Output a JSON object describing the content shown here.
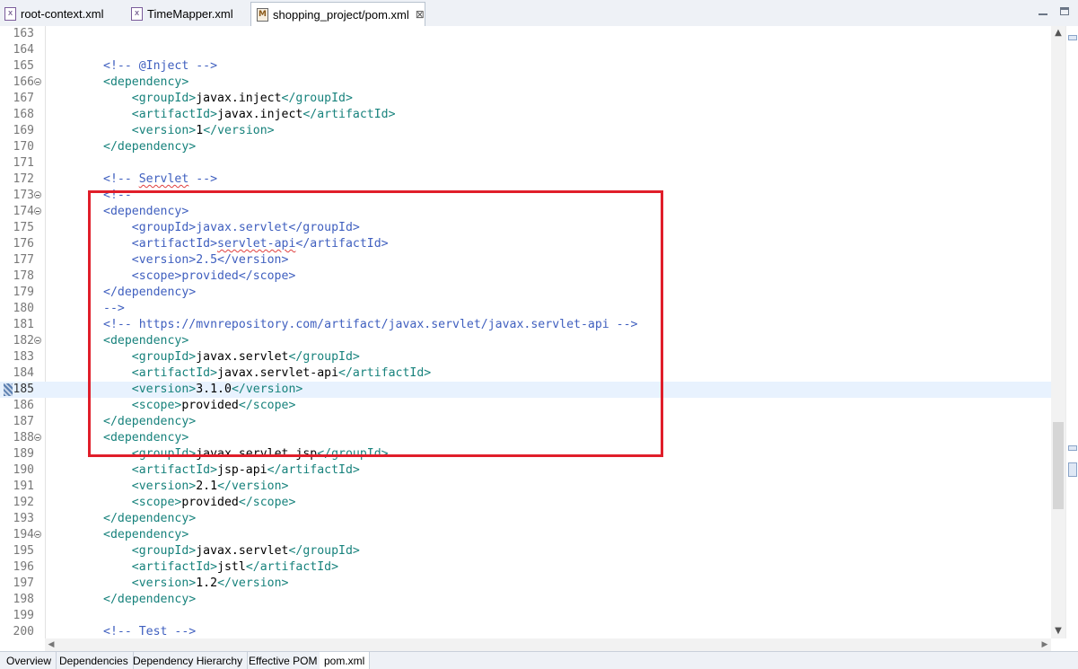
{
  "tabs": [
    {
      "label": "root-context.xml",
      "icon": "xml-file-error-icon"
    },
    {
      "label": "TimeMapper.xml",
      "icon": "xml-file-icon"
    },
    {
      "label": "shopping_project/pom.xml",
      "icon": "maven-pom-icon",
      "active": true,
      "close": "⊠"
    }
  ],
  "lines": [
    {
      "n": "163",
      "tokens": []
    },
    {
      "n": "164",
      "tokens": []
    },
    {
      "n": "165",
      "tokens": [
        {
          "c": "com",
          "t": "<!-- @Inject -->"
        }
      ]
    },
    {
      "n": "166",
      "fold": true,
      "tokens": [
        {
          "c": "tag",
          "t": "<dependency>"
        }
      ]
    },
    {
      "n": "167",
      "tokens": [
        {
          "c": "sp",
          "t": "    "
        },
        {
          "c": "tag",
          "t": "<groupId>"
        },
        {
          "c": "txt",
          "t": "javax.inject"
        },
        {
          "c": "tag",
          "t": "</groupId>"
        }
      ]
    },
    {
      "n": "168",
      "tokens": [
        {
          "c": "sp",
          "t": "    "
        },
        {
          "c": "tag",
          "t": "<artifactId>"
        },
        {
          "c": "txt",
          "t": "javax.inject"
        },
        {
          "c": "tag",
          "t": "</artifactId>"
        }
      ]
    },
    {
      "n": "169",
      "tokens": [
        {
          "c": "sp",
          "t": "    "
        },
        {
          "c": "tag",
          "t": "<version>"
        },
        {
          "c": "txt",
          "t": "1"
        },
        {
          "c": "tag",
          "t": "</version>"
        }
      ]
    },
    {
      "n": "170",
      "tokens": [
        {
          "c": "tag",
          "t": "</dependency>"
        }
      ]
    },
    {
      "n": "171",
      "tokens": []
    },
    {
      "n": "172",
      "tokens": [
        {
          "c": "com",
          "t": "<!-- "
        },
        {
          "c": "com squig",
          "t": "Servlet"
        },
        {
          "c": "com",
          "t": " -->"
        }
      ]
    },
    {
      "n": "173",
      "fold": true,
      "tokens": [
        {
          "c": "com",
          "t": "<!--"
        }
      ]
    },
    {
      "n": "174",
      "fold": true,
      "tokens": [
        {
          "c": "com",
          "t": "<dependency>"
        }
      ]
    },
    {
      "n": "175",
      "tokens": [
        {
          "c": "com",
          "t": "    <groupId>javax.servlet</groupId>"
        }
      ]
    },
    {
      "n": "176",
      "tokens": [
        {
          "c": "com",
          "t": "    <artifactId>"
        },
        {
          "c": "com squig",
          "t": "servlet-api"
        },
        {
          "c": "com",
          "t": "</artifactId>"
        }
      ]
    },
    {
      "n": "177",
      "tokens": [
        {
          "c": "com",
          "t": "    <version>2.5</version>"
        }
      ]
    },
    {
      "n": "178",
      "tokens": [
        {
          "c": "com",
          "t": "    <scope>provided</scope>"
        }
      ]
    },
    {
      "n": "179",
      "tokens": [
        {
          "c": "com",
          "t": "</dependency>"
        }
      ]
    },
    {
      "n": "180",
      "tokens": [
        {
          "c": "com",
          "t": "-->"
        }
      ]
    },
    {
      "n": "181",
      "tokens": [
        {
          "c": "com",
          "t": "<!-- https://mvnrepository.com/artifact/javax.servlet/javax.servlet-api -->"
        }
      ]
    },
    {
      "n": "182",
      "fold": true,
      "tokens": [
        {
          "c": "tag",
          "t": "<dependency>"
        }
      ]
    },
    {
      "n": "183",
      "tokens": [
        {
          "c": "sp",
          "t": "    "
        },
        {
          "c": "tag",
          "t": "<groupId>"
        },
        {
          "c": "txt",
          "t": "javax.servlet"
        },
        {
          "c": "tag",
          "t": "</groupId>"
        }
      ]
    },
    {
      "n": "184",
      "tokens": [
        {
          "c": "sp",
          "t": "    "
        },
        {
          "c": "tag",
          "t": "<artifactId>"
        },
        {
          "c": "txt",
          "t": "javax.servlet-api"
        },
        {
          "c": "tag",
          "t": "</artifactId>"
        }
      ]
    },
    {
      "n": "185",
      "current": true,
      "tokens": [
        {
          "c": "sp",
          "t": "    "
        },
        {
          "c": "tag",
          "t": "<version>"
        },
        {
          "c": "txt",
          "t": "3.1.0"
        },
        {
          "c": "tag",
          "t": "</version>"
        }
      ]
    },
    {
      "n": "186",
      "tokens": [
        {
          "c": "sp",
          "t": "    "
        },
        {
          "c": "tag",
          "t": "<scope>"
        },
        {
          "c": "txt",
          "t": "provided"
        },
        {
          "c": "tag",
          "t": "</scope>"
        }
      ]
    },
    {
      "n": "187",
      "tokens": [
        {
          "c": "tag",
          "t": "</dependency>"
        }
      ]
    },
    {
      "n": "188",
      "fold": true,
      "tokens": [
        {
          "c": "tag",
          "t": "<dependency>"
        }
      ]
    },
    {
      "n": "189",
      "tokens": [
        {
          "c": "sp",
          "t": "    "
        },
        {
          "c": "tag",
          "t": "<groupId>"
        },
        {
          "c": "txt",
          "t": "javax.servlet.jsp"
        },
        {
          "c": "tag",
          "t": "</groupId>"
        }
      ]
    },
    {
      "n": "190",
      "tokens": [
        {
          "c": "sp",
          "t": "    "
        },
        {
          "c": "tag",
          "t": "<artifactId>"
        },
        {
          "c": "txt",
          "t": "jsp-api"
        },
        {
          "c": "tag",
          "t": "</artifactId>"
        }
      ]
    },
    {
      "n": "191",
      "tokens": [
        {
          "c": "sp",
          "t": "    "
        },
        {
          "c": "tag",
          "t": "<version>"
        },
        {
          "c": "txt",
          "t": "2.1"
        },
        {
          "c": "tag",
          "t": "</version>"
        }
      ]
    },
    {
      "n": "192",
      "tokens": [
        {
          "c": "sp",
          "t": "    "
        },
        {
          "c": "tag",
          "t": "<scope>"
        },
        {
          "c": "txt",
          "t": "provided"
        },
        {
          "c": "tag",
          "t": "</scope>"
        }
      ]
    },
    {
      "n": "193",
      "tokens": [
        {
          "c": "tag",
          "t": "</dependency>"
        }
      ]
    },
    {
      "n": "194",
      "fold": true,
      "tokens": [
        {
          "c": "tag",
          "t": "<dependency>"
        }
      ]
    },
    {
      "n": "195",
      "tokens": [
        {
          "c": "sp",
          "t": "    "
        },
        {
          "c": "tag",
          "t": "<groupId>"
        },
        {
          "c": "txt",
          "t": "javax.servlet"
        },
        {
          "c": "tag",
          "t": "</groupId>"
        }
      ]
    },
    {
      "n": "196",
      "tokens": [
        {
          "c": "sp",
          "t": "    "
        },
        {
          "c": "tag",
          "t": "<artifactId>"
        },
        {
          "c": "txt",
          "t": "jstl"
        },
        {
          "c": "tag",
          "t": "</artifactId>"
        }
      ]
    },
    {
      "n": "197",
      "tokens": [
        {
          "c": "sp",
          "t": "    "
        },
        {
          "c": "tag",
          "t": "<version>"
        },
        {
          "c": "txt",
          "t": "1.2"
        },
        {
          "c": "tag",
          "t": "</version>"
        }
      ]
    },
    {
      "n": "198",
      "tokens": [
        {
          "c": "tag",
          "t": "</dependency>"
        }
      ]
    },
    {
      "n": "199",
      "tokens": []
    },
    {
      "n": "200",
      "tokens": [
        {
          "c": "com",
          "t": "<!-- Test -->"
        }
      ]
    }
  ],
  "bottom_tabs": [
    {
      "label": "Overview"
    },
    {
      "label": "Dependencies"
    },
    {
      "label": "Dependency Hierarchy"
    },
    {
      "label": "Effective POM"
    },
    {
      "label": "pom.xml",
      "active": true
    }
  ],
  "colors": {
    "comment": "#3f5fbf",
    "tag": "#17827c",
    "text": "#000000",
    "highlight_box": "#e01e2a",
    "current_line": "#e8f2fe"
  }
}
